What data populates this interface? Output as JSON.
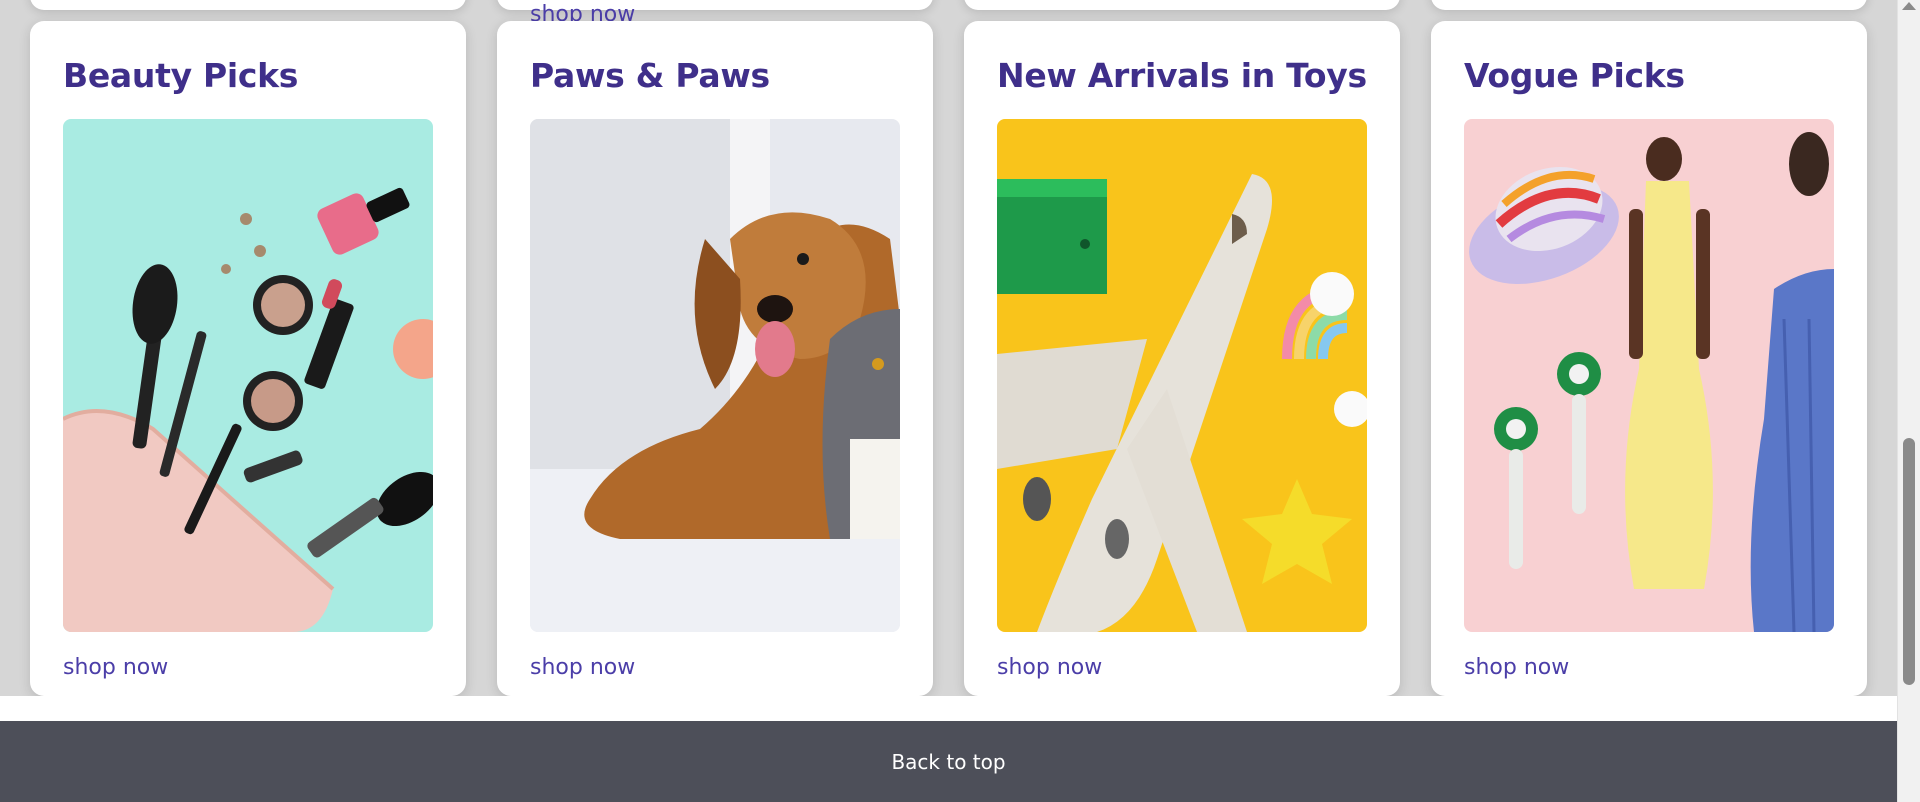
{
  "previous_row": {
    "link_label": "shop now"
  },
  "cards": [
    {
      "title": "Beauty Picks",
      "link_label": "shop now",
      "image_name": "beauty-products-image"
    },
    {
      "title": "Paws & Paws",
      "link_label": "shop now",
      "image_name": "dog-and-cat-image"
    },
    {
      "title": "New Arrivals in Toys",
      "link_label": "shop now",
      "image_name": "toy-airplane-image"
    },
    {
      "title": "Vogue Picks",
      "link_label": "shop now",
      "image_name": "fashion-picks-image"
    }
  ],
  "footer": {
    "back_to_top_label": "Back to top"
  },
  "colors": {
    "title": "#3f2f8a",
    "link": "#4b3ea8",
    "footer_bg": "#4d4f59",
    "page_bg": "#d6d6d6"
  }
}
